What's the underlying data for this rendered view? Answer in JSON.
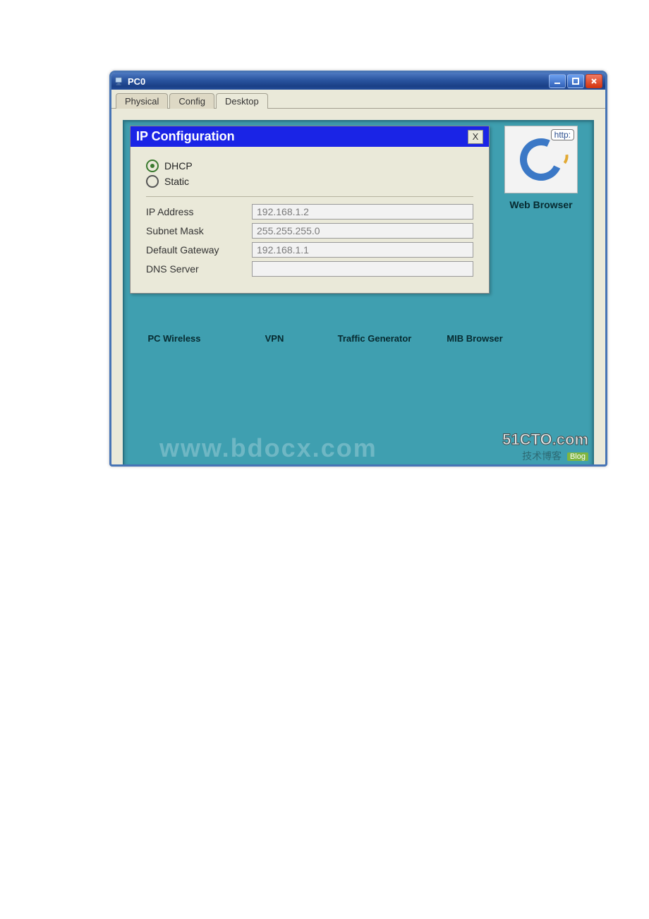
{
  "window": {
    "title": "PC0",
    "tabs": [
      {
        "label": "Physical",
        "active": false
      },
      {
        "label": "Config",
        "active": false
      },
      {
        "label": "Desktop",
        "active": true
      }
    ]
  },
  "ip_config": {
    "title": "IP Configuration",
    "close_glyph": "X",
    "mode": {
      "dhcp_label": "DHCP",
      "static_label": "Static",
      "selected": "dhcp"
    },
    "fields": {
      "ip_address": {
        "label": "IP Address",
        "value": "192.168.1.2"
      },
      "subnet_mask": {
        "label": "Subnet Mask",
        "value": "255.255.255.0"
      },
      "default_gateway": {
        "label": "Default Gateway",
        "value": "192.168.1.1"
      },
      "dns_server": {
        "label": "DNS Server",
        "value": ""
      }
    }
  },
  "desktop_apps": {
    "pc_wireless": "PC Wireless",
    "vpn": "VPN",
    "traffic_generator": "Traffic Generator",
    "mib_browser": "MIB Browser",
    "web_browser": "Web Browser",
    "web_browser_tooltip": "http:"
  },
  "watermarks": {
    "center": "www.bdocx.com",
    "right_line1": "51CTO.com",
    "right_line2": "技术博客",
    "right_badge": "Blog"
  }
}
